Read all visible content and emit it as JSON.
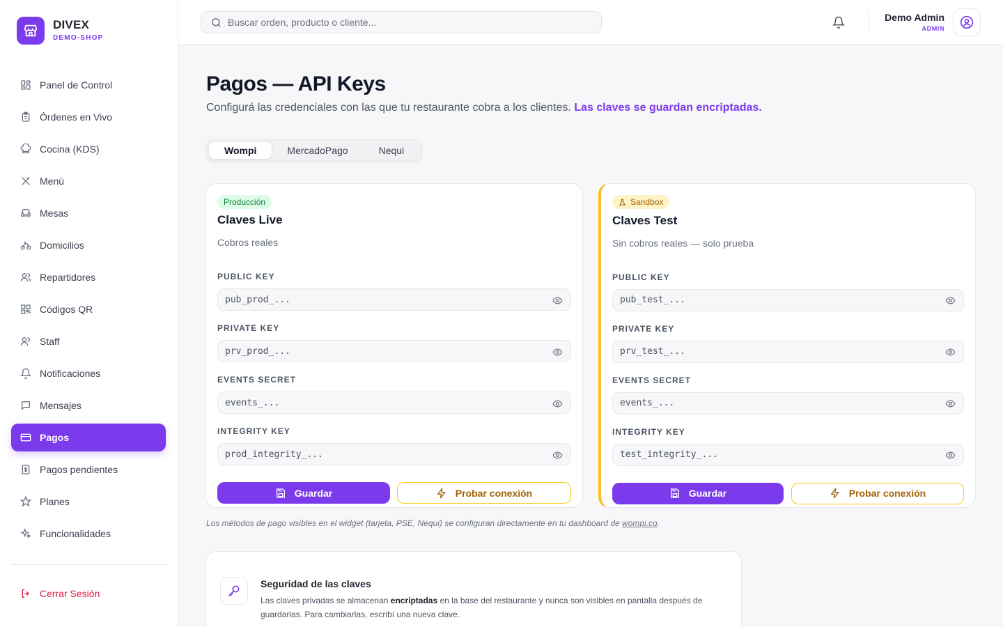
{
  "brand": {
    "name": "DIVEX",
    "sub": "DEMO-SHOP"
  },
  "sidebar": {
    "items": [
      {
        "label": "Panel de Control",
        "icon": "dashboard-icon"
      },
      {
        "label": "Órdenes en Vivo",
        "icon": "clipboard-icon"
      },
      {
        "label": "Cocina (KDS)",
        "icon": "chef-hat-icon"
      },
      {
        "label": "Menú",
        "icon": "utensils-icon"
      },
      {
        "label": "Mesas",
        "icon": "armchair-icon"
      },
      {
        "label": "Domicilios",
        "icon": "bike-icon"
      },
      {
        "label": "Repartidores",
        "icon": "users-icon"
      },
      {
        "label": "Códigos QR",
        "icon": "qr-code-icon"
      },
      {
        "label": "Staff",
        "icon": "user-group-icon"
      },
      {
        "label": "Notificaciones",
        "icon": "bell-icon"
      },
      {
        "label": "Mensajes",
        "icon": "message-icon"
      },
      {
        "label": "Pagos",
        "icon": "credit-card-icon",
        "active": true
      },
      {
        "label": "Pagos pendientes",
        "icon": "receipt-icon"
      },
      {
        "label": "Planes",
        "icon": "star-icon"
      },
      {
        "label": "Funcionalidades",
        "icon": "sparkles-icon"
      }
    ],
    "logout": "Cerrar Sesión"
  },
  "header": {
    "search_placeholder": "Buscar orden, producto o cliente...",
    "user_name": "Demo Admin",
    "user_role": "ADMIN"
  },
  "page": {
    "title": "Pagos — API Keys",
    "desc": "Configurá las credenciales con las que tu restaurante cobra a los clientes.",
    "desc_highlight": "Las claves se guardan encriptadas."
  },
  "tabs": [
    {
      "label": "Wompi",
      "active": true
    },
    {
      "label": "MercadoPago"
    },
    {
      "label": "Nequi"
    }
  ],
  "live": {
    "badge": "Producción",
    "title": "Claves Live",
    "sub": "Cobros reales",
    "fields": [
      {
        "label": "PUBLIC KEY",
        "placeholder": "pub_prod_..."
      },
      {
        "label": "PRIVATE KEY",
        "placeholder": "prv_prod_..."
      },
      {
        "label": "EVENTS SECRET",
        "placeholder": "events_..."
      },
      {
        "label": "INTEGRITY KEY",
        "placeholder": "prod_integrity_..."
      }
    ],
    "save": "Guardar",
    "test": "Probar conexión"
  },
  "test": {
    "badge": "Sandbox",
    "title": "Claves Test",
    "sub": "Sin cobros reales — solo prueba",
    "fields": [
      {
        "label": "PUBLIC KEY",
        "placeholder": "pub_test_..."
      },
      {
        "label": "PRIVATE KEY",
        "placeholder": "prv_test_..."
      },
      {
        "label": "EVENTS SECRET",
        "placeholder": "events_..."
      },
      {
        "label": "INTEGRITY KEY",
        "placeholder": "test_integrity_..."
      }
    ],
    "save": "Guardar",
    "test": "Probar conexión"
  },
  "footnote": {
    "text": "Los métodos de pago visibles en el widget (tarjeta, PSE, Nequi) se configuran directamente en tu dashboard de",
    "link": "wompi.co",
    "end": "."
  },
  "security": {
    "title": "Seguridad de las claves",
    "text_a": "Las claves privadas se almacenan",
    "text_bold": "encriptadas",
    "text_b": "en la base del restaurante y nunca son visibles en pantalla después de guardarlas. Para cambiarlas, escribí una nueva clave."
  },
  "colors": {
    "accent": "#7c3aed",
    "danger": "#e11d48",
    "sandbox": "#fbbf24",
    "success": "#15803d"
  }
}
